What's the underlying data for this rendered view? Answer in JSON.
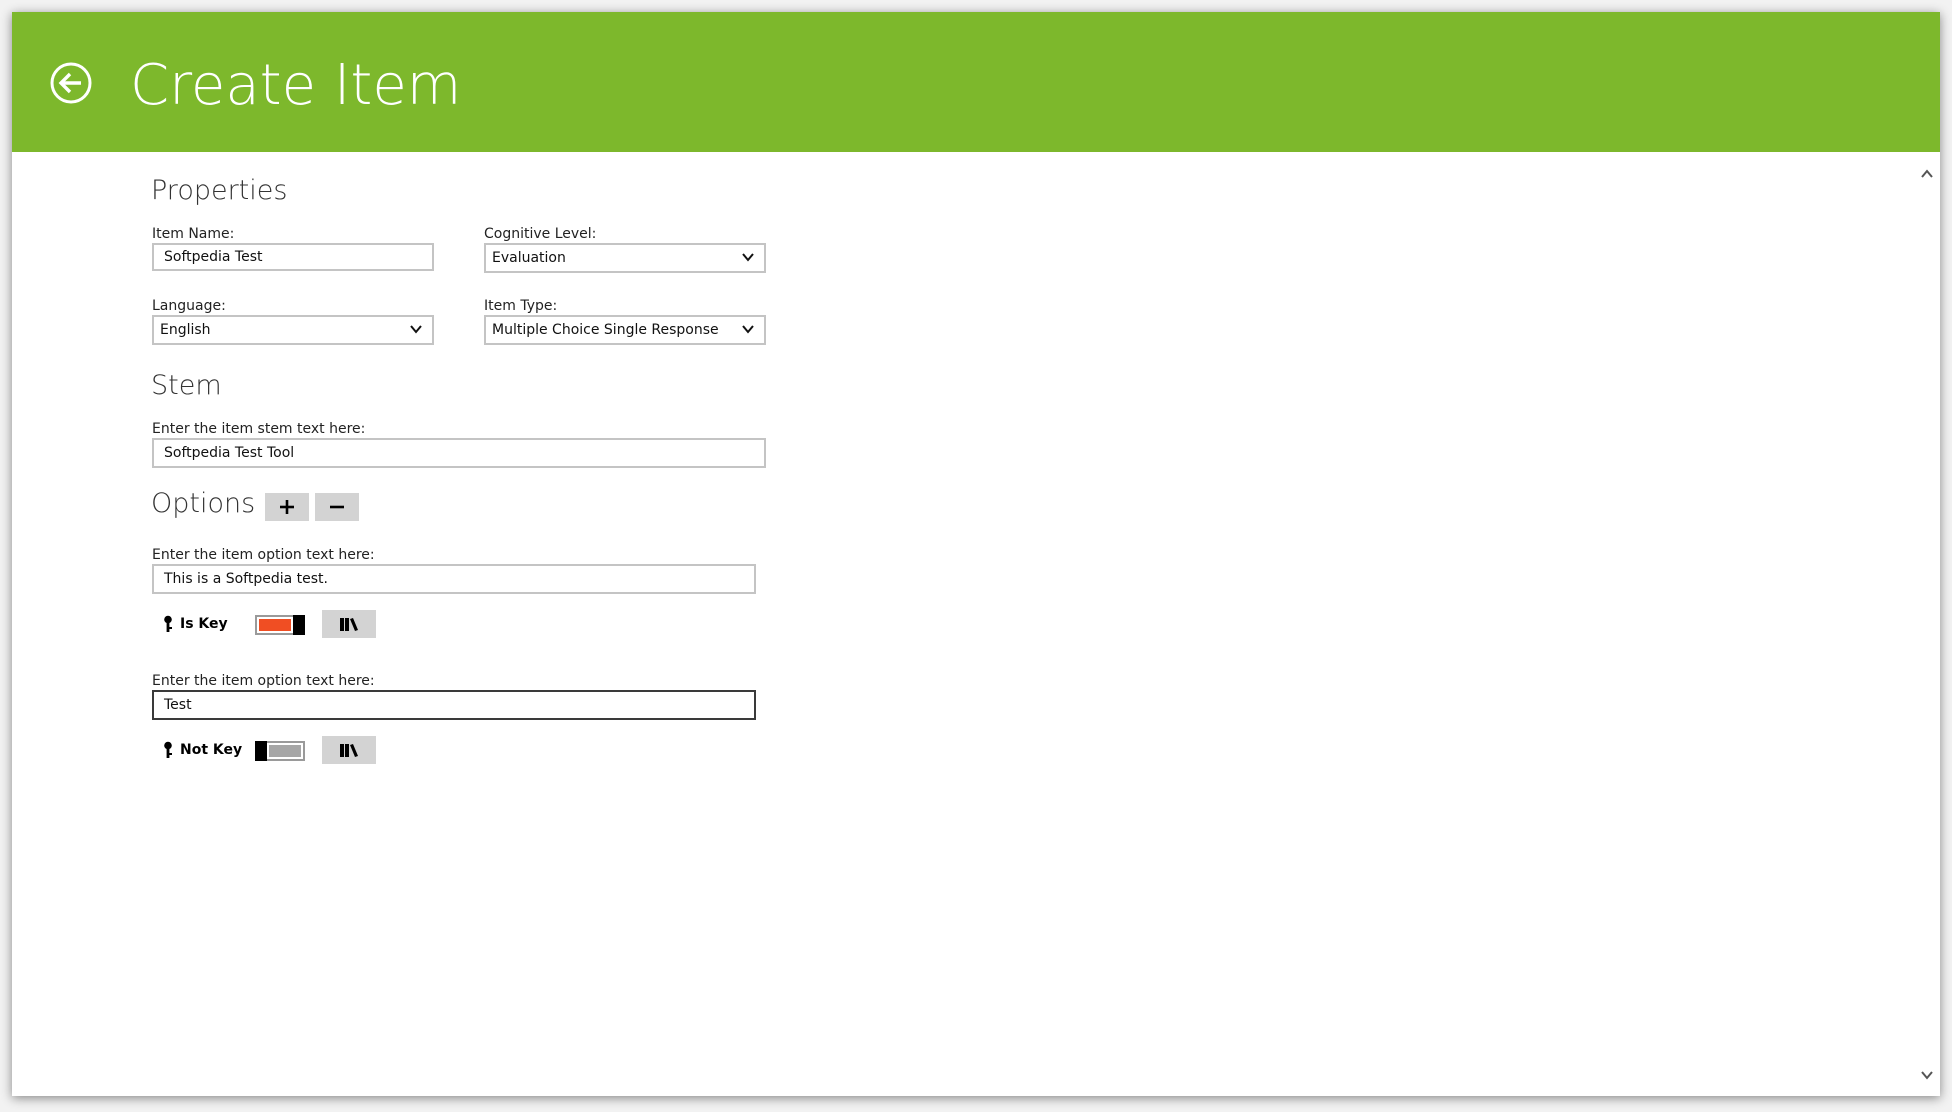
{
  "header": {
    "title": "Create Item",
    "color": "#7db82c"
  },
  "properties": {
    "title": "Properties",
    "item_name": {
      "label": "Item Name:",
      "value": "Softpedia Test"
    },
    "cognitive_level": {
      "label": "Cognitive Level:",
      "value": "Evaluation"
    },
    "language": {
      "label": "Language:",
      "value": "English"
    },
    "item_type": {
      "label": "Item Type:",
      "value": "Multiple Choice Single Response"
    }
  },
  "stem": {
    "title": "Stem",
    "label": "Enter the item stem text here:",
    "value": "Softpedia Test Tool"
  },
  "options": {
    "title": "Options",
    "add_icon": "plus-icon",
    "remove_icon": "minus-icon",
    "items": [
      {
        "label": "Enter the item option text here:",
        "value": "This is a Softpedia test.",
        "key_label": "Is Key",
        "is_key": true,
        "toggle_color": "#f04e23"
      },
      {
        "label": "Enter the item option text here:",
        "value": "Test",
        "key_label": "Not Key",
        "is_key": false,
        "toggle_color": "#a6a6a6"
      }
    ]
  }
}
